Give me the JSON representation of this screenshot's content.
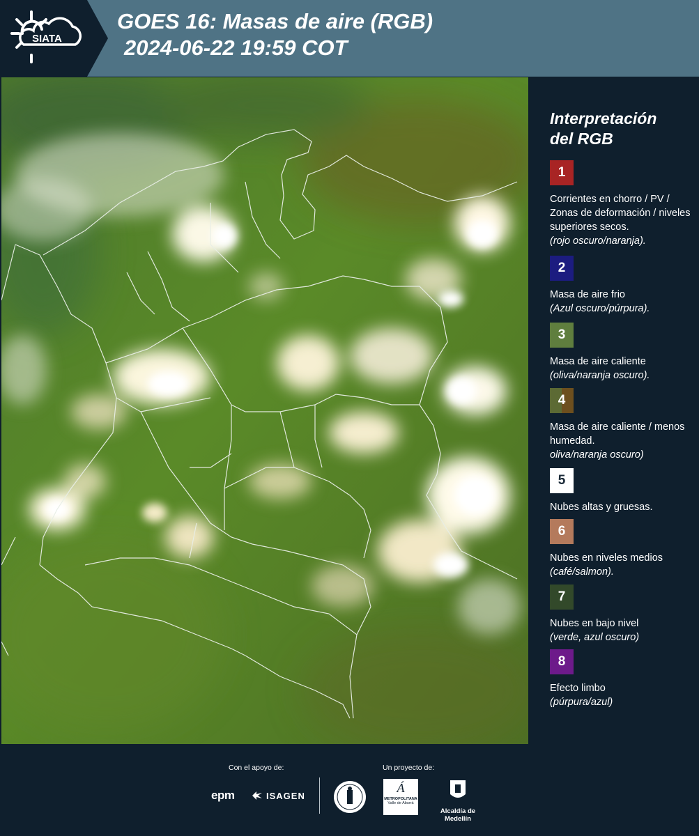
{
  "header": {
    "logo_text": "SIATA",
    "title_line1": "GOES 16: Masas de aire (RGB)",
    "title_line2": "2024-06-22 19:59 COT"
  },
  "legend": {
    "title_line1": "Interpretación",
    "title_line2": "del RGB",
    "items": [
      {
        "number": "1",
        "color": "#a82424",
        "text": "Corrientes en chorro / PV / Zonas de deformación / niveles superiores secos.",
        "note": "(rojo oscuro/naranja)."
      },
      {
        "number": "2",
        "color": "#1c1c80",
        "text": "Masa de aire frio",
        "note": "(Azul oscuro/púrpura)."
      },
      {
        "number": "3",
        "color": "#5f7e3e",
        "text": "Masa de aire caliente",
        "note": "(oliva/naranja oscuro)."
      },
      {
        "number": "4",
        "color": "#6b5a2a",
        "text": "Masa de aire caliente / menos humedad.",
        "note": "oliva/naranja oscuro)"
      },
      {
        "number": "5",
        "color": "#ffffff",
        "text": "Nubes altas y gruesas.",
        "note": ""
      },
      {
        "number": "6",
        "color": "#b47a5c",
        "text": "Nubes en niveles medios",
        "note": "(café/salmon)."
      },
      {
        "number": "7",
        "color": "#32492a",
        "text": "Nubes en bajo nivel",
        "note": "(verde, azul oscuro)"
      },
      {
        "number": "8",
        "color": "#6d1a8a",
        "text": "Efecto limbo",
        "note": "(púrpura/azul)"
      }
    ]
  },
  "footer": {
    "support_label": "Con el apoyo de:",
    "project_label": "Un proyecto de:",
    "sponsors": [
      "epm",
      "ISAGEN"
    ],
    "partners": [
      "METROPOLITANA",
      "Valle de Aburrá",
      "Alcaldía de Medellín"
    ]
  }
}
